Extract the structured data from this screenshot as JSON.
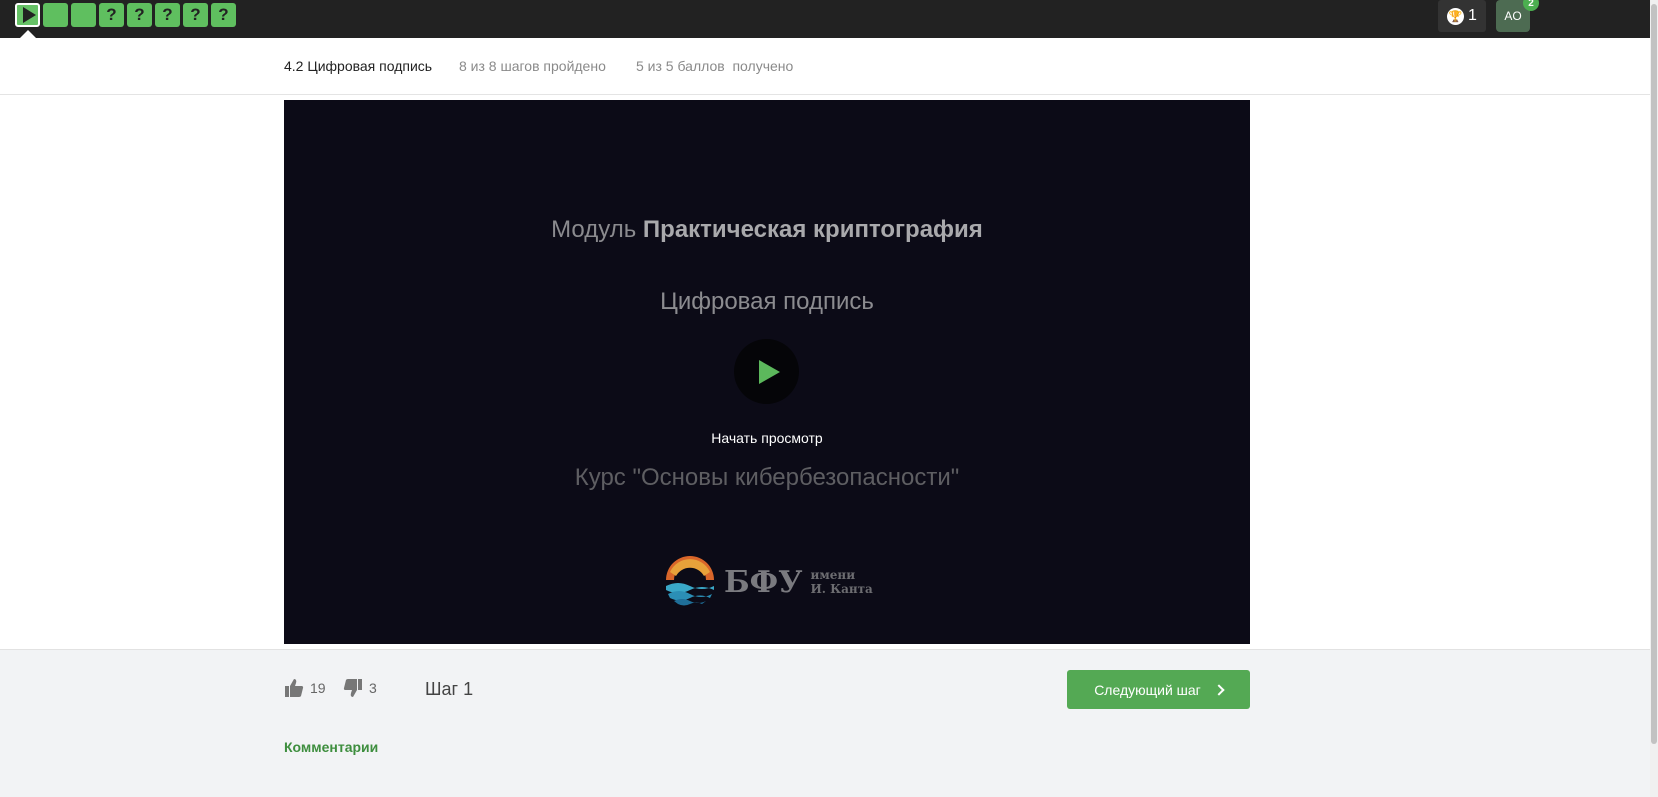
{
  "topbar": {
    "steps": [
      {
        "type": "video",
        "label": ""
      },
      {
        "type": "text",
        "label": ""
      },
      {
        "type": "text",
        "label": ""
      },
      {
        "type": "quiz",
        "label": "?"
      },
      {
        "type": "quiz",
        "label": "?"
      },
      {
        "type": "quiz",
        "label": "?"
      },
      {
        "type": "quiz",
        "label": "?"
      },
      {
        "type": "quiz",
        "label": "?"
      }
    ],
    "trophy_count": "1",
    "avatar_initials": "AO",
    "notification_count": "2"
  },
  "lesson": {
    "title": "4.2 Цифровая подпись",
    "progress": "8 из 8 шагов пройдено",
    "score": "5 из 5 баллов  получено"
  },
  "video": {
    "module_prefix": "Модуль ",
    "module_name": "Практическая криптография",
    "topic": "Цифровая подпись",
    "start_label": "Начать просмотр",
    "course": "Курс \"Основы кибербезопасности\"",
    "logo_name": "БФУ",
    "logo_sub_line1": "имени",
    "logo_sub_line2": "И. Канта"
  },
  "footer": {
    "likes": "19",
    "dislikes": "3",
    "step_label": "Шаг 1",
    "next_label": "Следующий шаг",
    "comments_label": "Комментарии"
  },
  "colors": {
    "accent": "#5fbf5f",
    "button": "#54a954",
    "topbar": "#222222",
    "video_bg": "#0c0b17"
  }
}
